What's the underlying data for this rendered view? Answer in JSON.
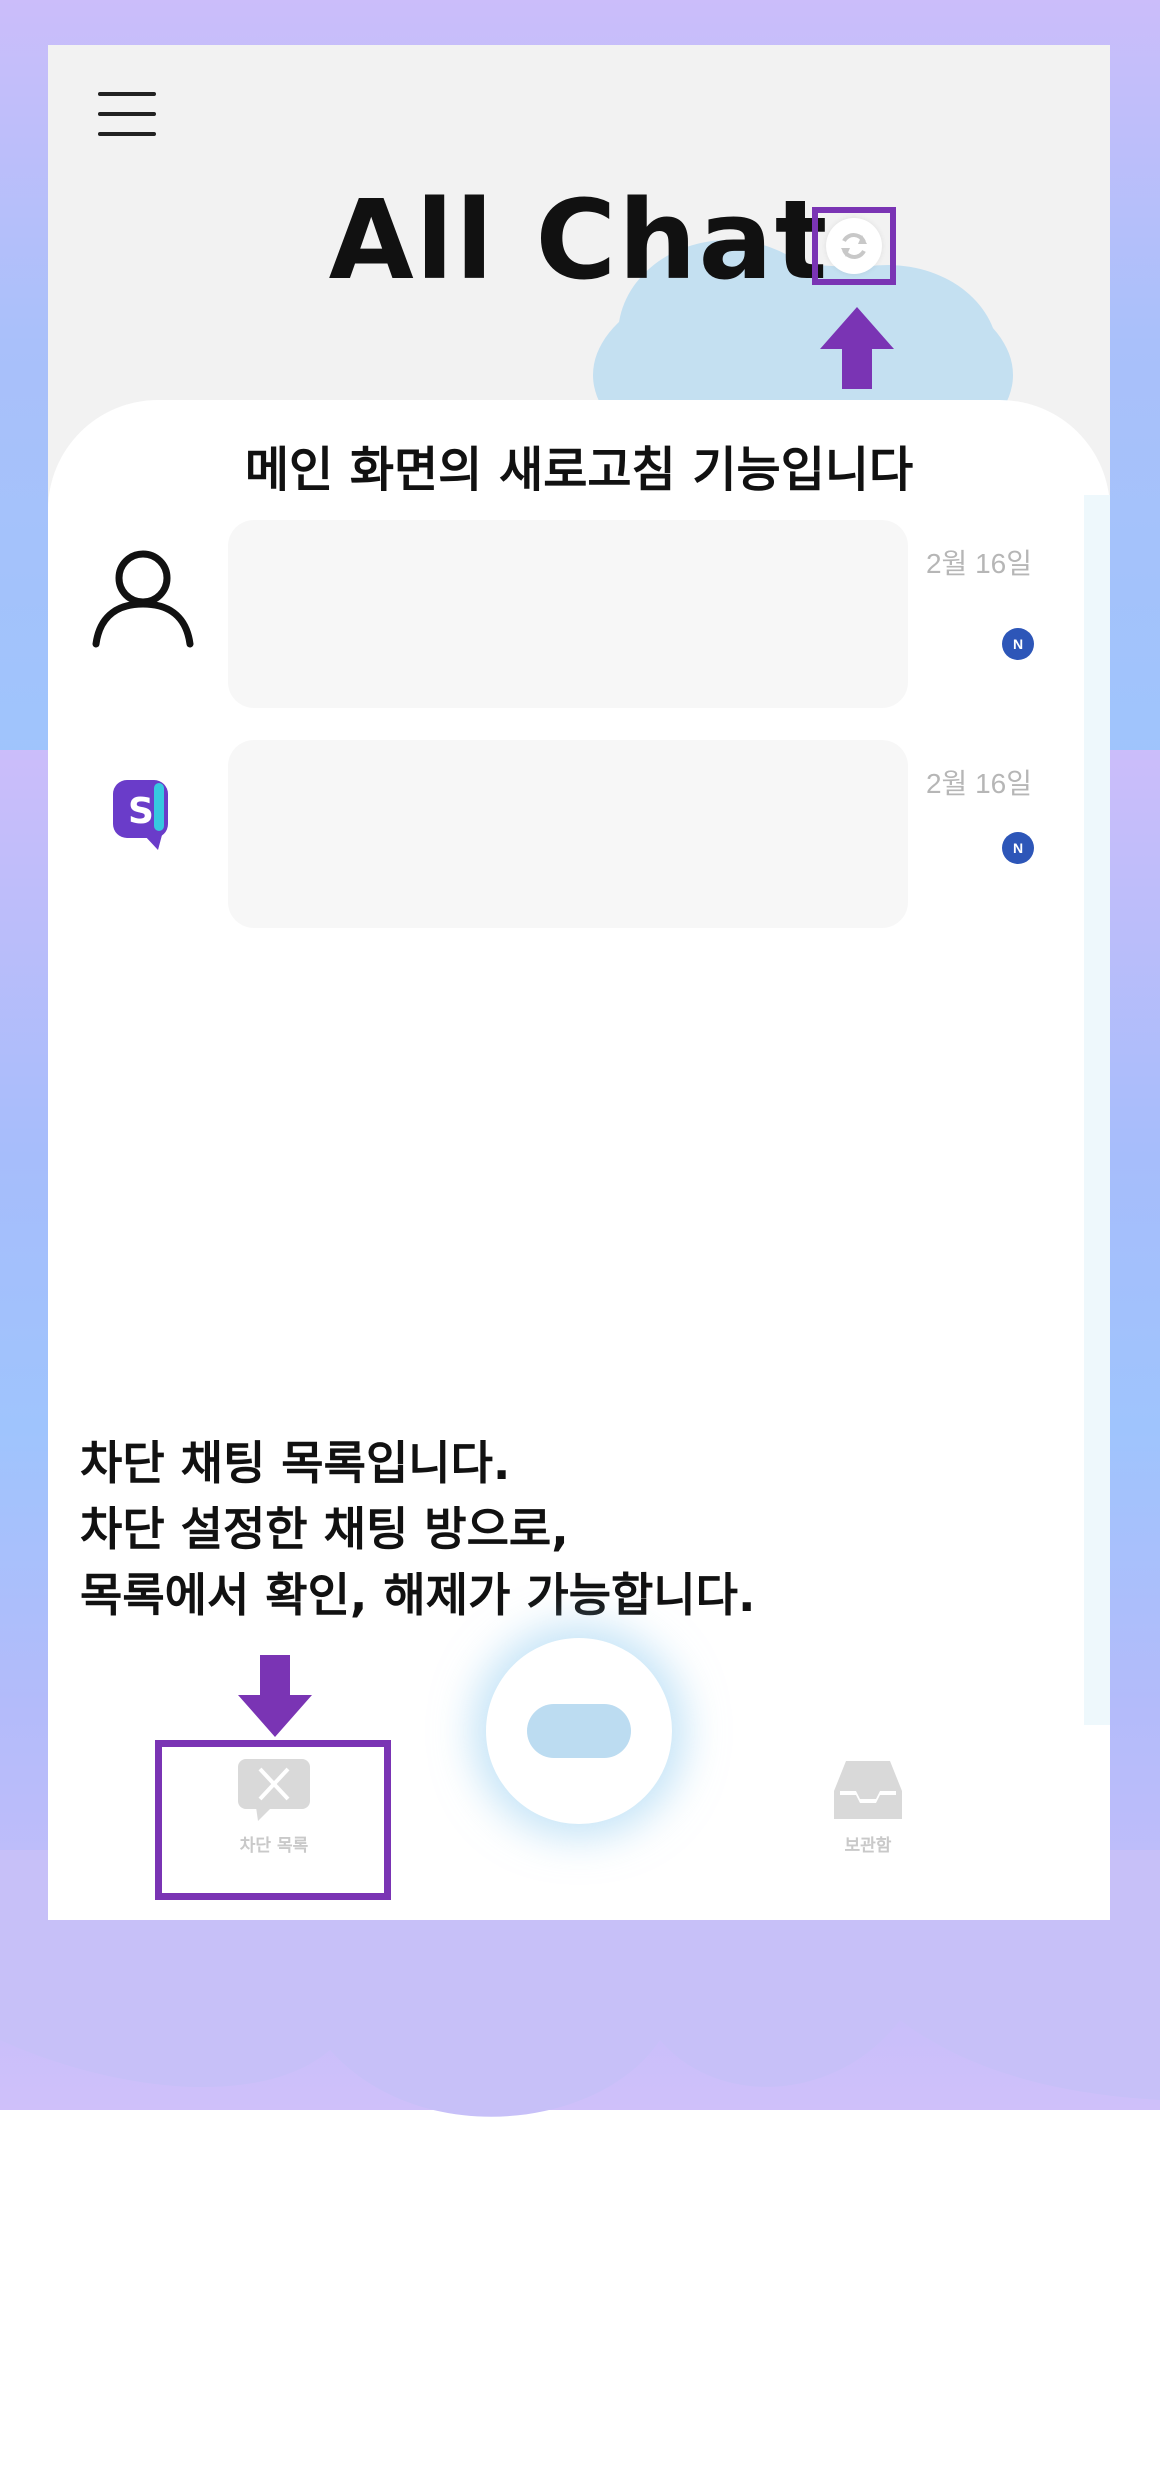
{
  "header": {
    "title": "All Chat"
  },
  "annotations": {
    "refresh_note": "메인 화면의 새로고침 기능입니다",
    "blocked_note": "차단 채팅 목록입니다.\n차단 설정한 채팅 방으로,\n목록에서 확인, 해제가 가능합니다."
  },
  "chats": [
    {
      "avatar": "user-outline-icon",
      "date": "2월 16일",
      "badge": "N"
    },
    {
      "avatar": "s-logo-icon",
      "date": "2월 16일",
      "badge": "N"
    }
  ],
  "nav": {
    "blocked_label": "차단 목록",
    "archive_label": "보관함"
  },
  "colors": {
    "highlight_border": "#7a34b4",
    "badge": "#2d56b8",
    "accent_cloud": "#bcdcf1"
  }
}
